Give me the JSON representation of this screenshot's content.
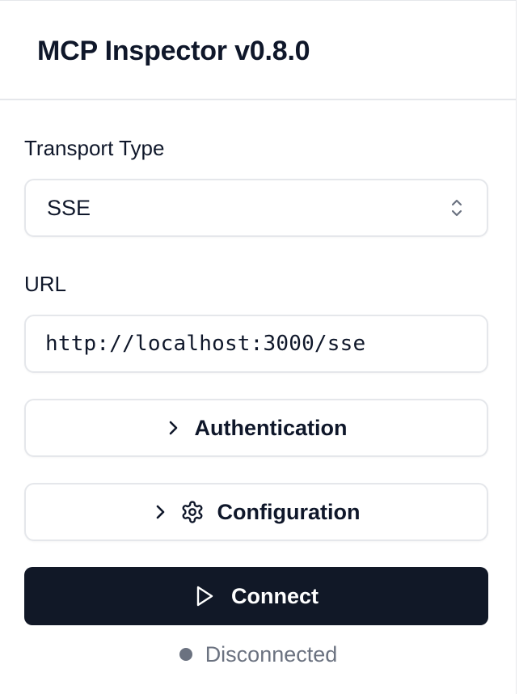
{
  "header": {
    "title": "MCP Inspector v0.8.0"
  },
  "transport": {
    "label": "Transport Type",
    "selected": "SSE",
    "icon": "chevrons-up-down-icon"
  },
  "url": {
    "label": "URL",
    "value": "http://localhost:3000/sse"
  },
  "authentication": {
    "label": "Authentication",
    "icon": "chevron-right-icon"
  },
  "configuration": {
    "label": "Configuration",
    "icons": [
      "chevron-right-icon",
      "gear-icon"
    ]
  },
  "connect": {
    "label": "Connect",
    "icon": "play-icon"
  },
  "status": {
    "text": "Disconnected",
    "dot_color": "#6b7280"
  },
  "colors": {
    "primary_button": "#111827",
    "border": "#e5e7eb",
    "text": "#0f172a",
    "muted": "#6b7280"
  }
}
